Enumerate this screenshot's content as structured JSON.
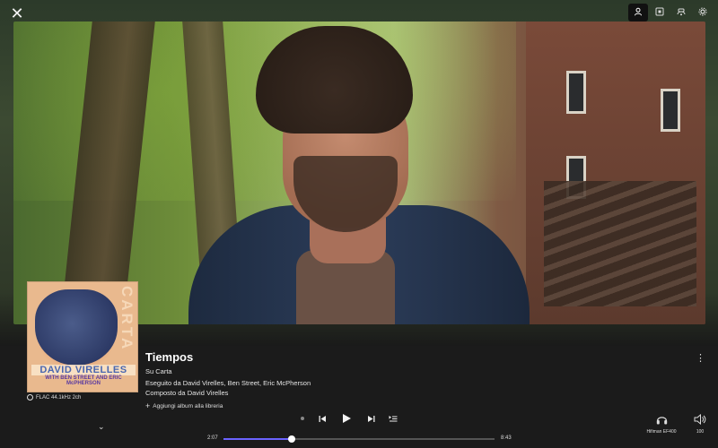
{
  "top_bar": {
    "close_icon": "close-icon",
    "buttons": [
      {
        "name": "profile-icon",
        "glyph": "👤",
        "active": true
      },
      {
        "name": "cast-icon",
        "glyph": "▣"
      },
      {
        "name": "queue-cloud-icon",
        "glyph": "☁"
      },
      {
        "name": "settings-icon",
        "glyph": "⚙"
      }
    ]
  },
  "album_cover": {
    "vertical_text": "CARTA",
    "artist_text": "DAVID VIRELLES",
    "with_text": "WITH BEN STREET AND ERIC McPHERSON"
  },
  "format": {
    "text": "FLAC 44.1kHz 2ch"
  },
  "track": {
    "title": "Tiempos",
    "album": "Su Carta",
    "performers": "Eseguito da David Virelles, Ben Street, Eric McPherson",
    "composer": "Composto da David Virelles",
    "add_to_library": "Aggiungi album alla libreria"
  },
  "playback": {
    "elapsed": "2:07",
    "duration": "8:43",
    "progress": 0.25
  },
  "output": {
    "device": "Hifiman EF400",
    "volume": "100"
  }
}
